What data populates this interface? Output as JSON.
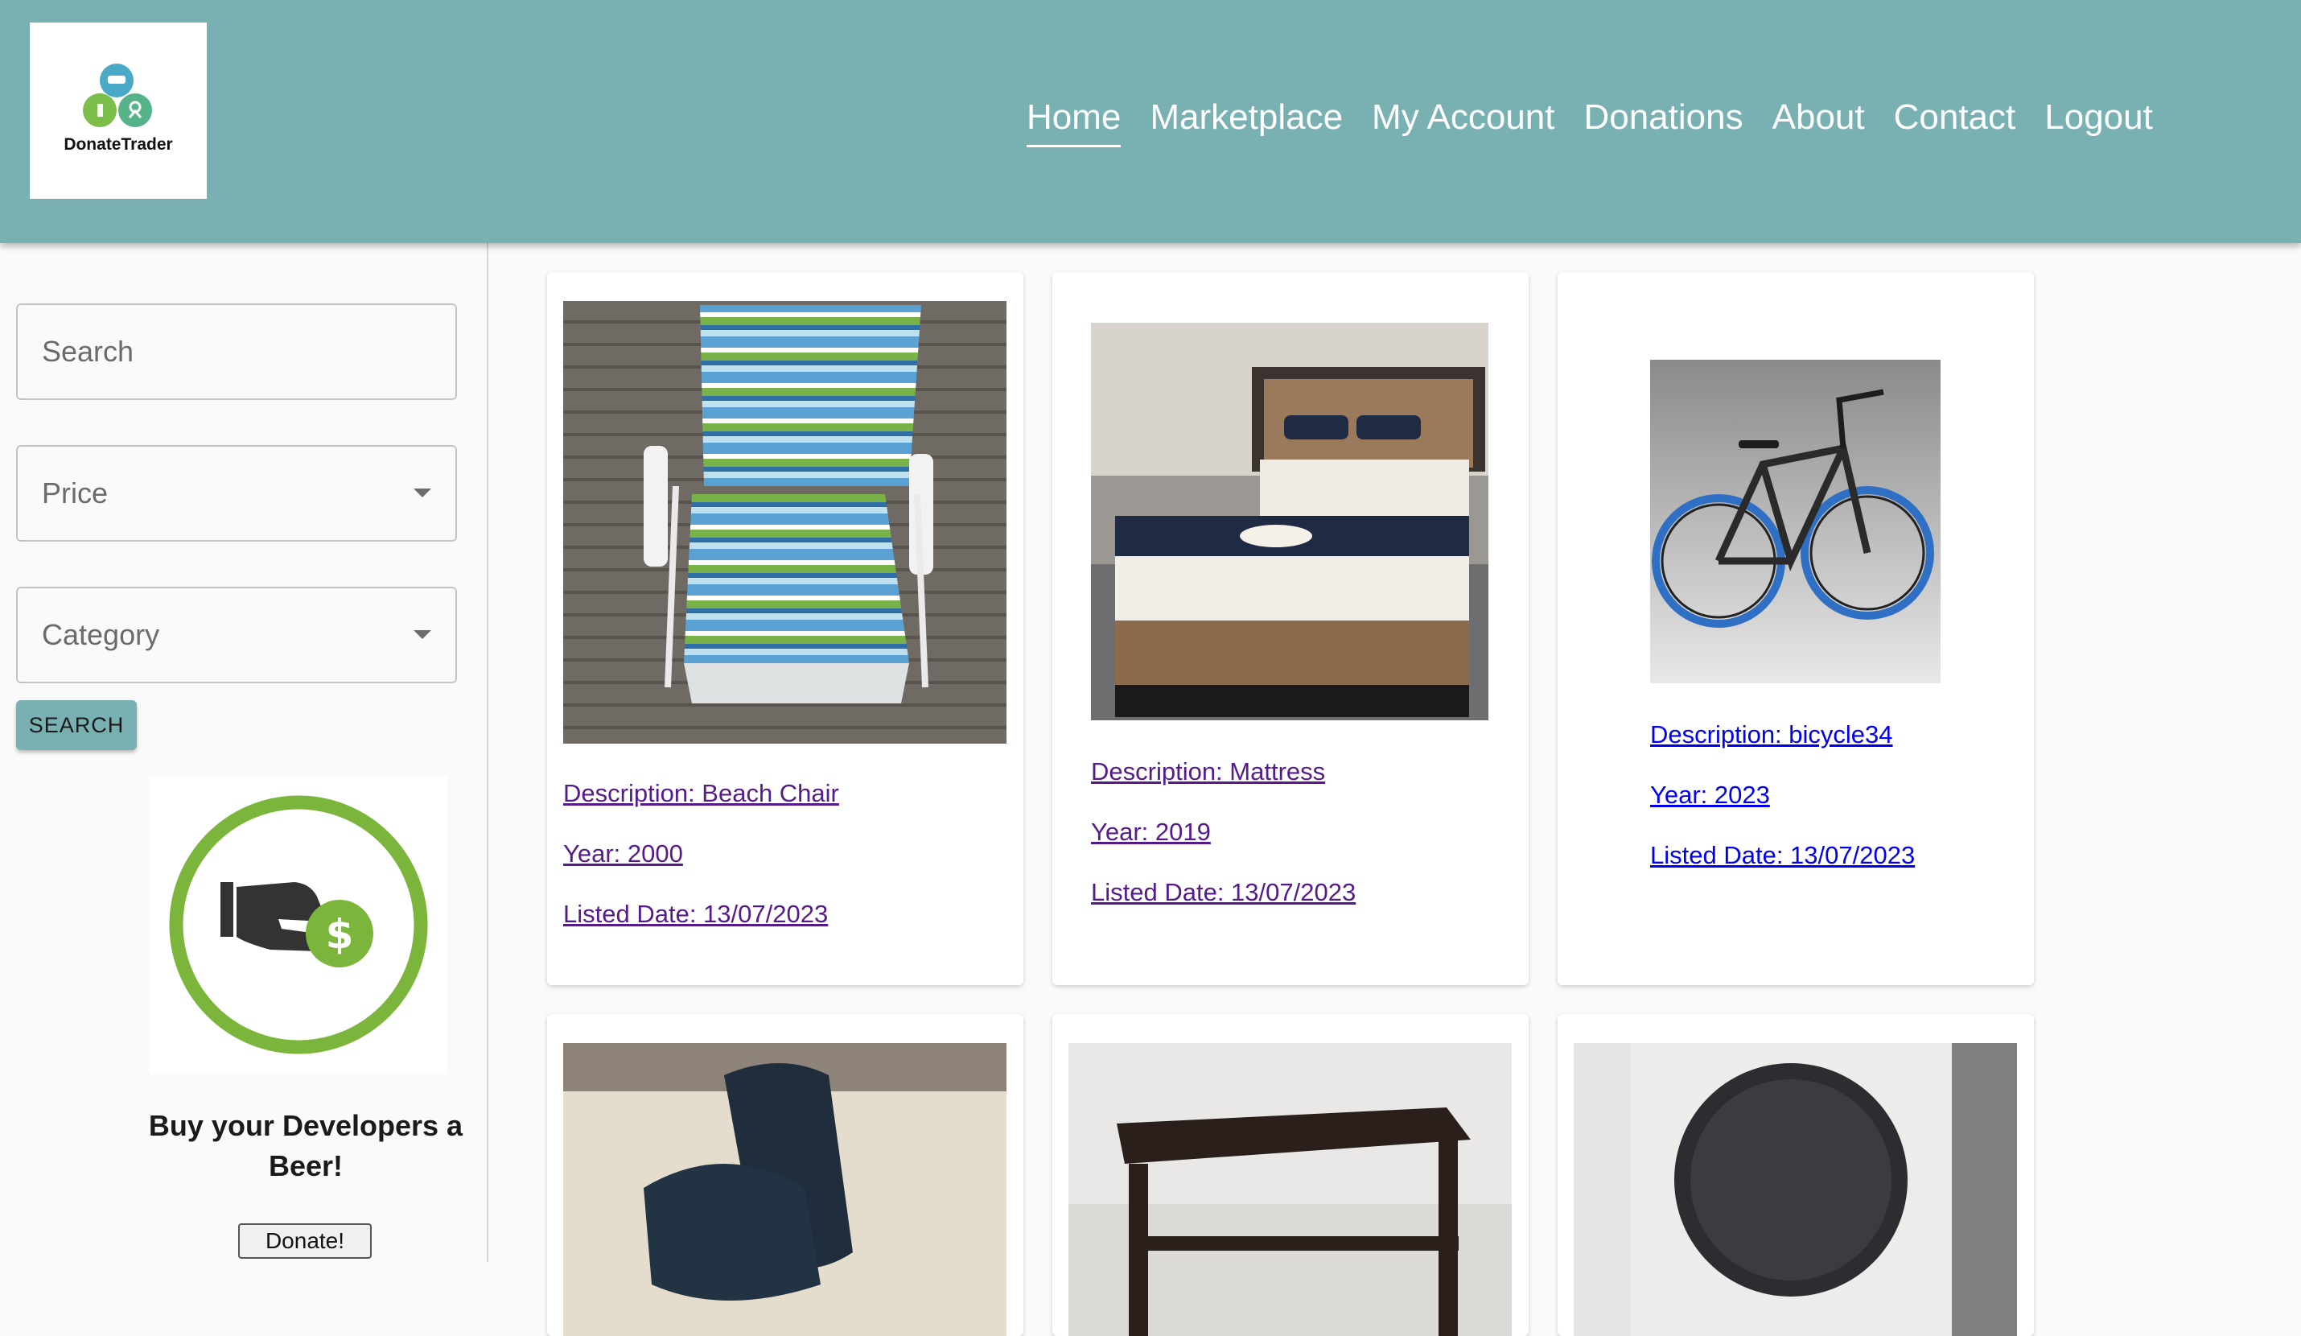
{
  "header": {
    "logo_text": "DonateTrader",
    "nav": [
      {
        "label": "Home",
        "active": true
      },
      {
        "label": "Marketplace"
      },
      {
        "label": "My Account"
      },
      {
        "label": "Donations"
      },
      {
        "label": "About"
      },
      {
        "label": "Contact"
      },
      {
        "label": "Logout"
      }
    ]
  },
  "sidebar": {
    "search_placeholder": "Search",
    "price_label": "Price",
    "category_label": "Category",
    "search_button": "SEARCH",
    "donate_text": "Buy your Developers a Beer!",
    "donate_button": "Donate!"
  },
  "listings": [
    {
      "description": "Description: Beach Chair",
      "year": "Year: 2000",
      "listed": "Listed Date: 13/07/2023",
      "image": "beach-chair-photo"
    },
    {
      "description": "Description: Mattress",
      "year": "Year: 2019",
      "listed": "Listed Date: 13/07/2023",
      "image": "mattress-photo"
    },
    {
      "description": "Description: bicycle34",
      "year": "Year: 2023",
      "listed": "Listed Date: 13/07/2023",
      "image": "bicycle-photo"
    },
    {
      "image": "shoes-photo"
    },
    {
      "image": "side-table-photo"
    },
    {
      "image": "washing-machine-photo"
    }
  ],
  "colors": {
    "header_bg": "#79b0b1",
    "link_visited": "#551a8b",
    "link_unvisited": "#0000ee",
    "donate_green": "#7cb53b"
  }
}
